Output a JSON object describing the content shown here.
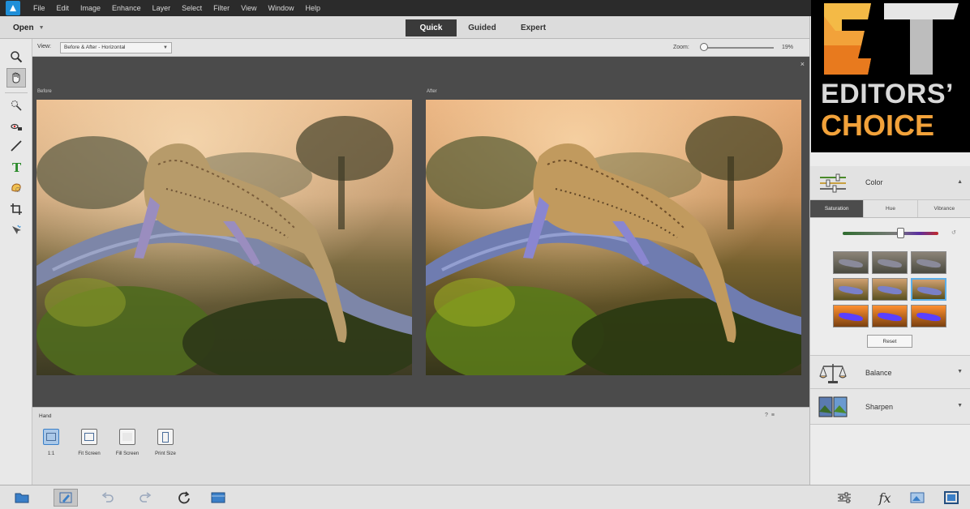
{
  "menubar": {
    "items": [
      "File",
      "Edit",
      "Image",
      "Enhance",
      "Layer",
      "Select",
      "Filter",
      "View",
      "Window",
      "Help"
    ]
  },
  "modebar": {
    "open_label": "Open",
    "tabs": [
      {
        "label": "Quick",
        "active": true
      },
      {
        "label": "Guided",
        "active": false
      },
      {
        "label": "Expert",
        "active": false
      }
    ]
  },
  "viewbar": {
    "view_label": "View:",
    "view_value": "Before & After - Horizontal",
    "zoom_label": "Zoom:",
    "zoom_value": "19%",
    "zoom_fraction": 0.0
  },
  "canvas": {
    "before_label": "Before",
    "after_label": "After",
    "close_symbol": "×"
  },
  "tool_options": {
    "title": "Hand",
    "help_label": "?",
    "buttons": [
      {
        "label": "1:1",
        "selected": true
      },
      {
        "label": "Fit Screen",
        "selected": false
      },
      {
        "label": "Fill Screen",
        "selected": false
      },
      {
        "label": "Print Size",
        "selected": false
      }
    ]
  },
  "badge": {
    "monogram": "ET",
    "line1": "EDITORS’",
    "line2": "CHOICE",
    "accent": "#f2a23a"
  },
  "adjustments": {
    "color": {
      "title": "Color",
      "tabs": [
        {
          "label": "Saturation",
          "active": true
        },
        {
          "label": "Hue",
          "active": false
        },
        {
          "label": "Vibrance",
          "active": false
        }
      ],
      "slider_fraction": 0.6,
      "reset_label": "Reset",
      "thumbnails": [
        {
          "tone": "gray-low",
          "selected": false
        },
        {
          "tone": "gray-low",
          "selected": false
        },
        {
          "tone": "gray-low",
          "selected": false
        },
        {
          "tone": "mid",
          "selected": false
        },
        {
          "tone": "mid",
          "selected": false
        },
        {
          "tone": "mid",
          "selected": true
        },
        {
          "tone": "high",
          "selected": false
        },
        {
          "tone": "high",
          "selected": false
        },
        {
          "tone": "high",
          "selected": false
        }
      ]
    },
    "balance": {
      "title": "Balance"
    },
    "sharpen": {
      "title": "Sharpen"
    }
  },
  "statusbar": {
    "fx_label": "fx"
  },
  "icons": {
    "tools": [
      "zoom-icon",
      "hand-icon",
      "quick-selection-icon",
      "red-eye-icon",
      "whiten-teeth-icon",
      "type-icon",
      "spot-healing-icon",
      "crop-icon",
      "move-icon"
    ]
  }
}
